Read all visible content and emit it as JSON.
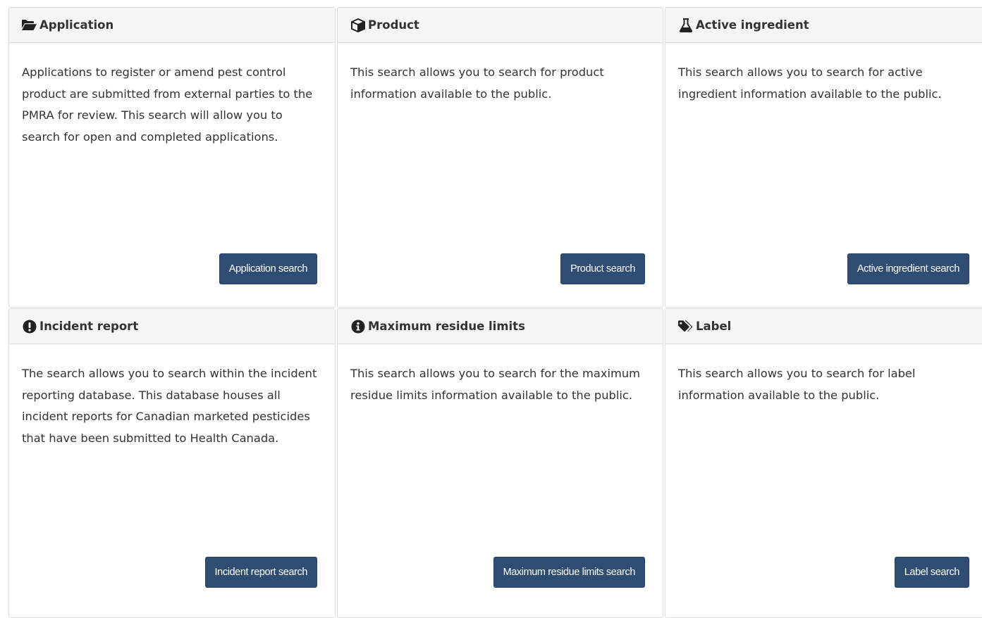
{
  "panels": {
    "application": {
      "icon": "folder-open-icon",
      "title": "Application",
      "body": "Applications to register or amend pest control product are submitted from external parties to the PMRA for review. This search will allow you to search for open and completed applications.",
      "button_label": "Application search"
    },
    "product": {
      "icon": "cube-icon",
      "title": "Product",
      "body": "This search allows you to search for product information available to the public.",
      "button_label": "Product search"
    },
    "active_ingredient": {
      "icon": "flask-icon",
      "title": "Active ingredient",
      "body": "This search allows you to search for active ingredient information available to the public.",
      "button_label": "Active ingredient search"
    },
    "incident_report": {
      "icon": "exclamation-circle-icon",
      "title": "Incident report",
      "body": "The search allows you to search within the incident reporting database. This database houses all incident reports for Canadian marketed pesticides that have been submitted to Health Canada.",
      "button_label": "Incident report search"
    },
    "maximum_residue_limits": {
      "icon": "info-circle-icon",
      "title": "Maximum residue limits",
      "body": "This search allows you to search for the maximum residue limits information available to the public.",
      "button_label": "Maximum residue limits search"
    },
    "label": {
      "icon": "tags-icon",
      "title": "Label",
      "body": "This search allows you to search for label information available to the public.",
      "button_label": "Label search"
    }
  },
  "colors": {
    "button_bg": "#2f4d73",
    "heading_bg": "#f5f5f5",
    "text": "#333333"
  }
}
